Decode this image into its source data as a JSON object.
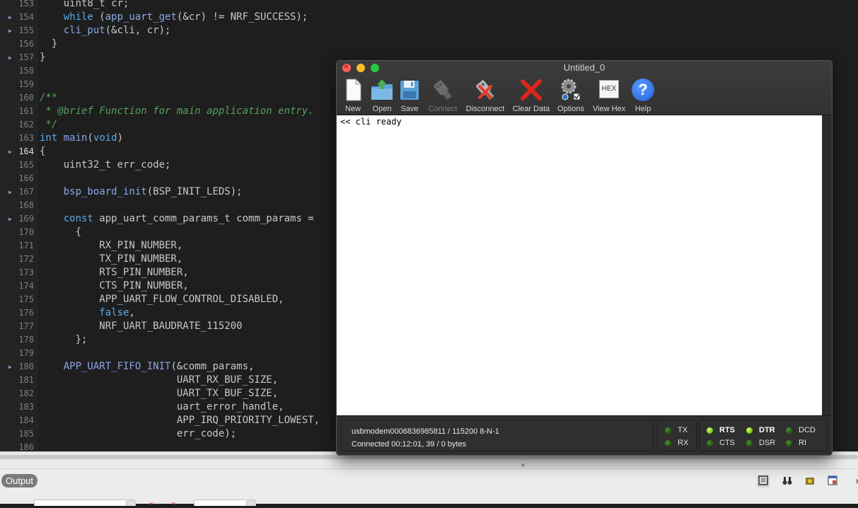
{
  "editor": {
    "lines": [
      {
        "num": "153",
        "fold": false,
        "text": "    uint8_t cr;"
      },
      {
        "num": "154",
        "fold": true,
        "text": "    while (app_uart_get(&cr) != NRF_SUCCESS);"
      },
      {
        "num": "155",
        "fold": true,
        "text": "    cli_put(&cli, cr);"
      },
      {
        "num": "156",
        "fold": false,
        "text": "  }"
      },
      {
        "num": "157",
        "fold": true,
        "text": "}"
      },
      {
        "num": "158",
        "fold": false,
        "text": ""
      },
      {
        "num": "159",
        "fold": false,
        "text": ""
      },
      {
        "num": "160",
        "fold": false,
        "text": "/**"
      },
      {
        "num": "161",
        "fold": false,
        "text": " * @brief Function for main application entry."
      },
      {
        "num": "162",
        "fold": false,
        "text": " */"
      },
      {
        "num": "163",
        "fold": false,
        "text": "int main(void)"
      },
      {
        "num": "164",
        "fold": true,
        "text": "{"
      },
      {
        "num": "165",
        "fold": false,
        "text": "    uint32_t err_code;"
      },
      {
        "num": "166",
        "fold": false,
        "text": ""
      },
      {
        "num": "167",
        "fold": true,
        "text": "    bsp_board_init(BSP_INIT_LEDS);"
      },
      {
        "num": "168",
        "fold": false,
        "text": ""
      },
      {
        "num": "169",
        "fold": true,
        "text": "    const app_uart_comm_params_t comm_params ="
      },
      {
        "num": "170",
        "fold": false,
        "text": "      {"
      },
      {
        "num": "171",
        "fold": false,
        "text": "          RX_PIN_NUMBER,"
      },
      {
        "num": "172",
        "fold": false,
        "text": "          TX_PIN_NUMBER,"
      },
      {
        "num": "173",
        "fold": false,
        "text": "          RTS_PIN_NUMBER,"
      },
      {
        "num": "174",
        "fold": false,
        "text": "          CTS_PIN_NUMBER,"
      },
      {
        "num": "175",
        "fold": false,
        "text": "          APP_UART_FLOW_CONTROL_DISABLED,"
      },
      {
        "num": "176",
        "fold": false,
        "text": "          false,"
      },
      {
        "num": "177",
        "fold": false,
        "text": "          NRF_UART_BAUDRATE_115200"
      },
      {
        "num": "178",
        "fold": false,
        "text": "      };"
      },
      {
        "num": "179",
        "fold": false,
        "text": ""
      },
      {
        "num": "180",
        "fold": true,
        "text": "    APP_UART_FIFO_INIT(&comm_params,"
      },
      {
        "num": "181",
        "fold": false,
        "text": "                       UART_RX_BUF_SIZE,"
      },
      {
        "num": "182",
        "fold": false,
        "text": "                       UART_TX_BUF_SIZE,"
      },
      {
        "num": "183",
        "fold": false,
        "text": "                       uart_error_handle,"
      },
      {
        "num": "184",
        "fold": false,
        "text": "                       APP_IRQ_PRIORITY_LOWEST,"
      },
      {
        "num": "185",
        "fold": false,
        "text": "                       err_code);"
      },
      {
        "num": "186",
        "fold": false,
        "text": ""
      }
    ],
    "current_line": "164"
  },
  "output_panel": {
    "tab_label": "Output"
  },
  "terminal_window": {
    "title": "Untitled_0",
    "toolbar": [
      {
        "label": "New",
        "icon": "new-document-icon",
        "enabled": true
      },
      {
        "label": "Open",
        "icon": "open-folder-icon",
        "enabled": true
      },
      {
        "label": "Save",
        "icon": "save-disk-icon",
        "enabled": true
      },
      {
        "label": "Connect",
        "icon": "connect-plug-icon",
        "enabled": false
      },
      {
        "label": "Disconnect",
        "icon": "disconnect-plug-icon",
        "enabled": true
      },
      {
        "label": "Clear Data",
        "icon": "clear-x-icon",
        "enabled": true
      },
      {
        "label": "Options",
        "icon": "options-gear-icon",
        "enabled": true
      },
      {
        "label": "View Hex",
        "icon": "hex-icon",
        "enabled": true
      },
      {
        "label": "Help",
        "icon": "help-question-icon",
        "enabled": true
      }
    ],
    "hex_icon_text": "HEX",
    "help_icon_text": "?",
    "terminal_text": "<< cli ready",
    "status": {
      "port_line": "usbmodem0006836985811 / 115200 8-N-1",
      "connection_line": "Connected 00:12:01, 39 / 0 bytes"
    },
    "signals": [
      {
        "label": "TX",
        "on": false
      },
      {
        "label": "RX",
        "on": false
      },
      {
        "label": "RTS",
        "on": true
      },
      {
        "label": "CTS",
        "on": false
      },
      {
        "label": "DTR",
        "on": true
      },
      {
        "label": "DSR",
        "on": false
      },
      {
        "label": "DCD",
        "on": false
      },
      {
        "label": "RI",
        "on": false
      }
    ]
  },
  "colors": {
    "editor_bg": "#1e1e1e",
    "keyword": "#5aa9e6",
    "comment": "#56a05a",
    "led_on": "#6fcf10",
    "led_off": "#1f5a10"
  }
}
